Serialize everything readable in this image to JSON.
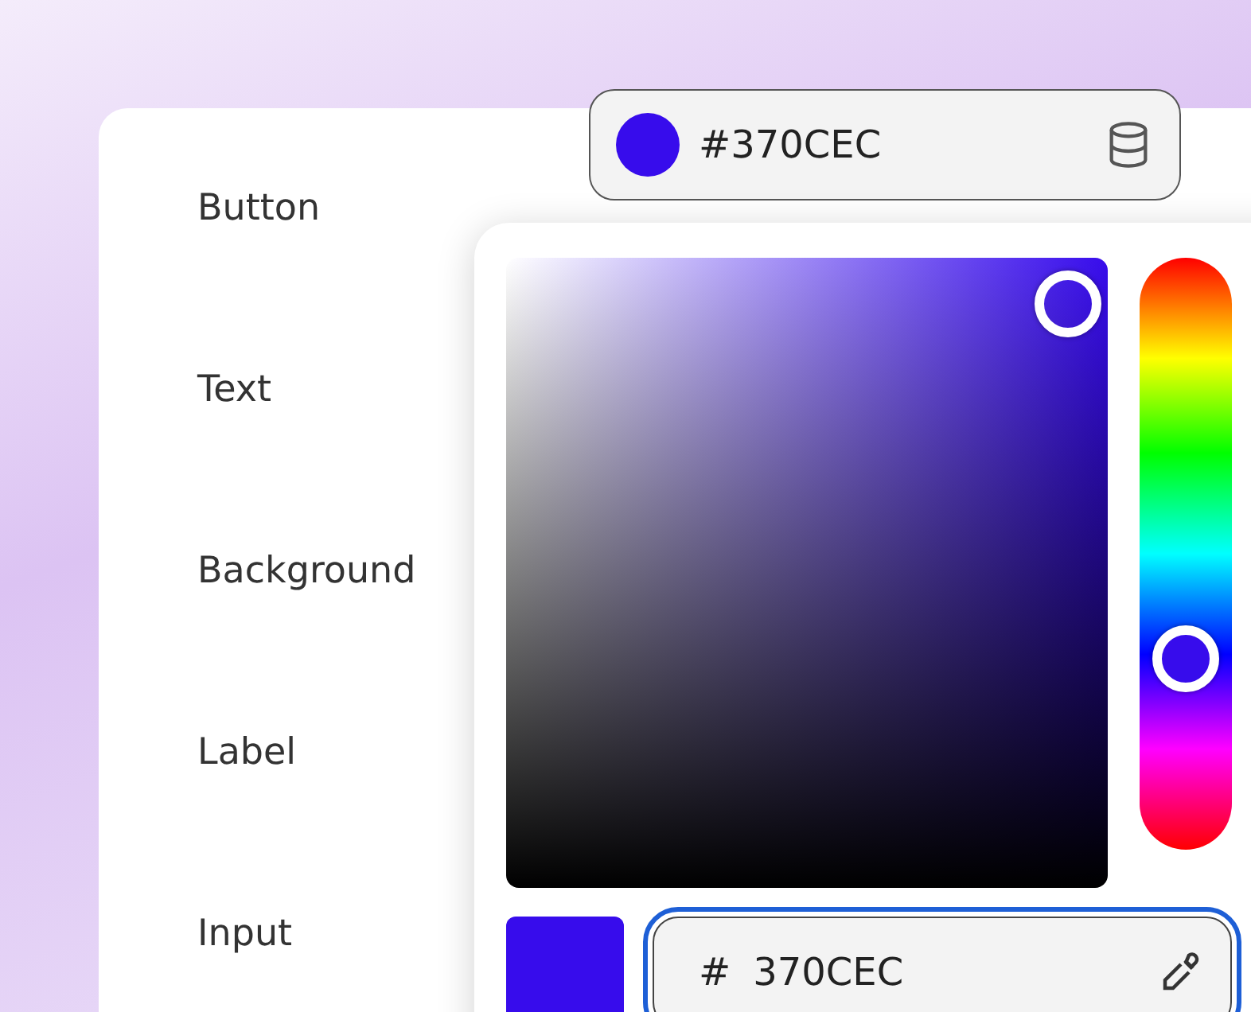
{
  "labels": [
    {
      "text": "Button"
    },
    {
      "text": "Text"
    },
    {
      "text": "Background"
    },
    {
      "text": "Label"
    },
    {
      "text": "Input"
    }
  ],
  "color_field": {
    "value": "#370CEC",
    "color": "#370cec"
  },
  "picker": {
    "color": "#370cec",
    "hex_input": {
      "prefix": "#",
      "value": "370CEC",
      "focused": true
    }
  }
}
